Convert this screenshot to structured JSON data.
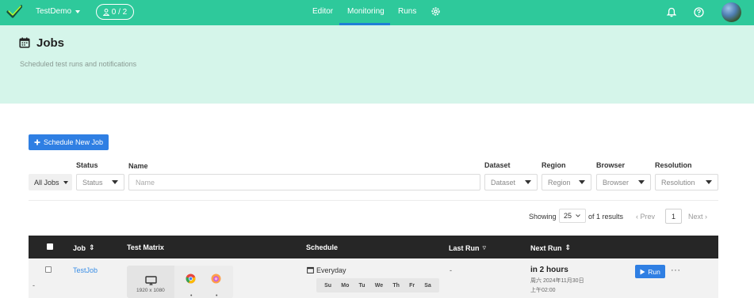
{
  "header": {
    "project_name": "TestDemo",
    "users_count": "0 / 2",
    "nav": [
      {
        "label": "Editor"
      },
      {
        "label": "Monitoring"
      },
      {
        "label": "Runs"
      }
    ],
    "active_tab": "Monitoring",
    "accent_color": "#2ec99b",
    "underline_color": "#1f7fd6",
    "icons": [
      "logo-check-icon",
      "user-icon",
      "settings-gear-icon",
      "bell-icon",
      "help-icon",
      "avatar"
    ]
  },
  "page": {
    "title": "Jobs",
    "subtitle": "Scheduled test runs and notifications",
    "banner_color": "#d5f5ea"
  },
  "toolbar": {
    "schedule_button": "Schedule New Job"
  },
  "filters": {
    "labels": {
      "status": "Status",
      "name": "Name",
      "dataset": "Dataset",
      "region": "Region",
      "browser": "Browser",
      "resolution": "Resolution"
    },
    "all_jobs": "All Jobs",
    "status_value": "Status",
    "name_placeholder": "Name",
    "dataset_value": "Dataset",
    "region_value": "Region",
    "browser_value": "Browser",
    "resolution_value": "Resolution"
  },
  "pagination": {
    "showing_label": "Showing",
    "page_size": "25",
    "results_text": "of 1 results",
    "prev_label": "Prev",
    "current_page": "1",
    "next_label": "Next"
  },
  "table": {
    "columns": {
      "job": "Job",
      "test_matrix": "Test Matrix",
      "schedule": "Schedule",
      "last_run": "Last Run",
      "next_run": "Next Run"
    },
    "rows": [
      {
        "job": "TestJob",
        "resolution": "1920 x 1080",
        "schedule": "Everyday",
        "days": [
          "Su",
          "Mo",
          "Tu",
          "We",
          "Th",
          "Fr",
          "Sa"
        ],
        "last_run": "-",
        "next_run": "in 2 hours",
        "next_run_date": "周六 2024年11月30日",
        "next_run_time": "上午02:00",
        "run_label": "Run",
        "row_marker": "-"
      }
    ]
  }
}
